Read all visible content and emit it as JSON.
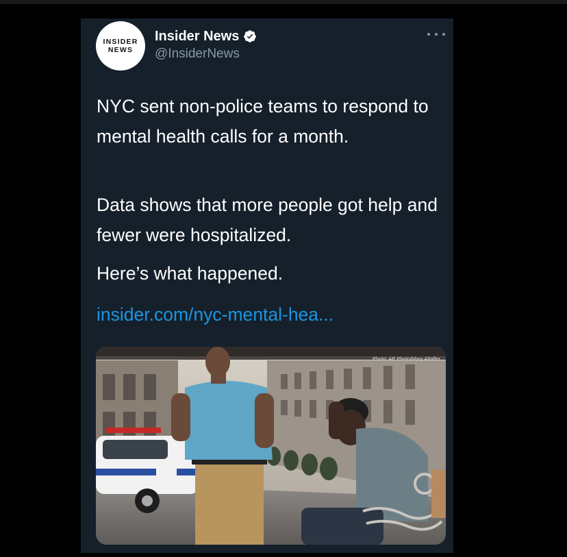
{
  "tweet": {
    "avatar_line1": "INSIDER",
    "avatar_line2": "NEWS",
    "display_name": "Insider News",
    "handle": "@InsiderNews",
    "verified": true,
    "paragraphs": [
      "NYC sent non-police teams to respond to mental health calls for a month.",
      "Data shows that more people got help and fewer were hospitalized.",
      "Here’s what happened."
    ],
    "link_text": "insider.com/nyc-mental-hea...",
    "photo_credit": "Photo: AP Photo/Mary Altaffer",
    "more_icon": "more-horizontal-icon",
    "accent_color": "#1b95e0",
    "background_color": "#15202b"
  }
}
